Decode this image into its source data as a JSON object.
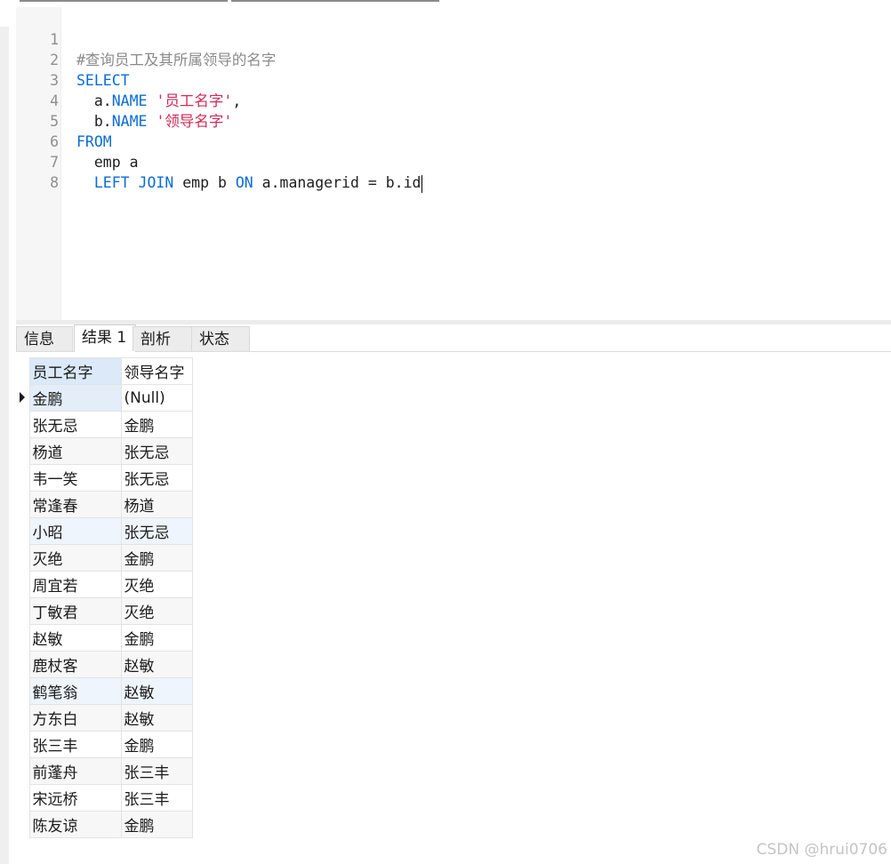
{
  "editor": {
    "lines": [
      {
        "n": "1",
        "comment": "#查询员工及其所属领导的名字"
      },
      {
        "n": "2",
        "kw1": "SELECT"
      },
      {
        "n": "3",
        "indent": "  ",
        "tbl": "a.",
        "col": "NAME",
        "str": "'员工名字'",
        "tail": ","
      },
      {
        "n": "4",
        "indent": "  ",
        "tbl": "b.",
        "col": "NAME",
        "str": "'领导名字'"
      },
      {
        "n": "5",
        "kw1": "FROM"
      },
      {
        "n": "6",
        "text": "  emp a"
      },
      {
        "n": "7",
        "indent": "  ",
        "kwA": "LEFT JOIN",
        "mid": " emp b ",
        "kwB": "ON",
        "rest": " a.managerid = b.id"
      },
      {
        "n": "8"
      }
    ]
  },
  "tabs": [
    {
      "label": "信息",
      "active": false
    },
    {
      "label": "结果 1",
      "active": true
    },
    {
      "label": "剖析",
      "active": false
    },
    {
      "label": "状态",
      "active": false
    }
  ],
  "results": {
    "columns": [
      "员工名字",
      "领导名字"
    ],
    "null_label": "(Null)",
    "rows": [
      [
        "金鹏",
        null
      ],
      [
        "张无忌",
        "金鹏"
      ],
      [
        "杨道",
        "张无忌"
      ],
      [
        "韦一笑",
        "张无忌"
      ],
      [
        "常逢春",
        "杨道"
      ],
      [
        "小昭",
        "张无忌"
      ],
      [
        "灭绝",
        "金鹏"
      ],
      [
        "周宜若",
        "灭绝"
      ],
      [
        "丁敏君",
        "灭绝"
      ],
      [
        "赵敏",
        "金鹏"
      ],
      [
        "鹿杖客",
        "赵敏"
      ],
      [
        "鹤笔翁",
        "赵敏"
      ],
      [
        "方东白",
        "赵敏"
      ],
      [
        "张三丰",
        "金鹏"
      ],
      [
        "前蓬舟",
        "张三丰"
      ],
      [
        "宋远桥",
        "张三丰"
      ],
      [
        "陈友谅",
        "金鹏"
      ]
    ]
  },
  "watermark": "CSDN @hrui0706",
  "icons": {
    "row_indicator": "current-row-arrow-icon"
  },
  "colors": {
    "keyword": "#0b6cd6",
    "string": "#d12a56",
    "comment": "#8a8a8a"
  }
}
